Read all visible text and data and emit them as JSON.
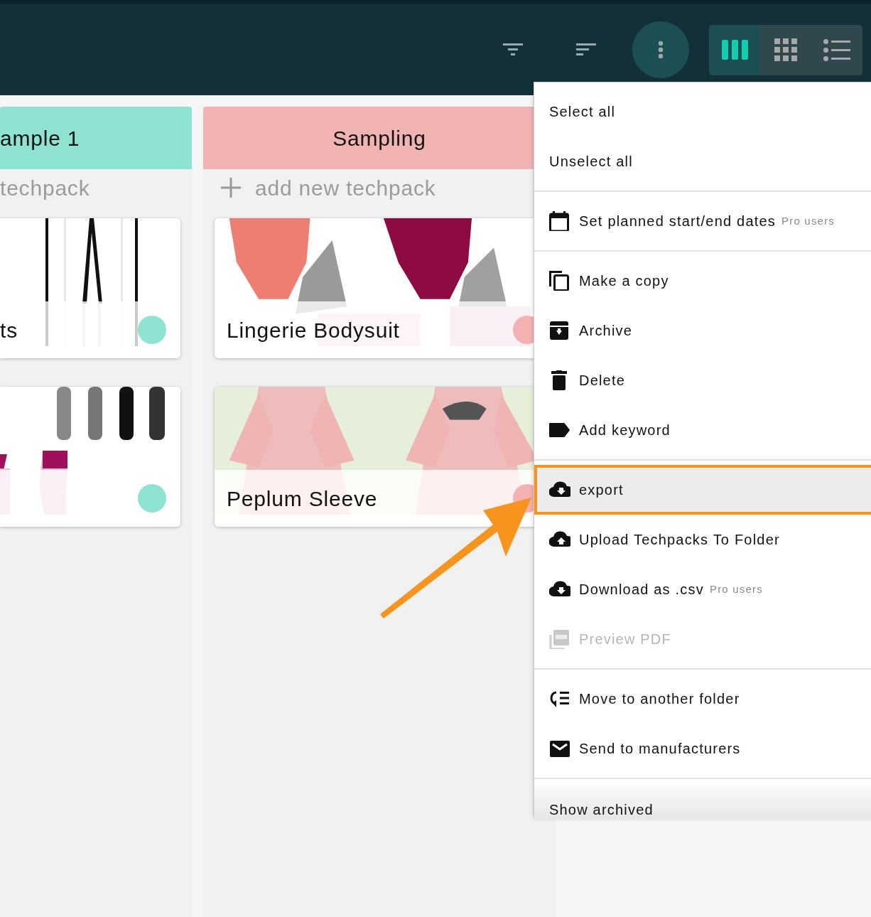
{
  "toolbar": {
    "view_modes": [
      {
        "kind": "columns",
        "selected": true
      },
      {
        "kind": "grid",
        "selected": false
      },
      {
        "kind": "list",
        "selected": false
      }
    ]
  },
  "columns": [
    {
      "title": "ample 1",
      "color": "#8fe3d2",
      "cut_off_left": true,
      "add_label": "techpack",
      "cards": [
        {
          "title": "ts",
          "color": "#8fe3d2",
          "kind": "picture"
        },
        {
          "color": "#8fe3d2",
          "kind": "picture"
        }
      ]
    },
    {
      "title": "Sampling",
      "color": "#f2b3b3",
      "cut_off_left": false,
      "add_label": "add new techpack",
      "cards": [
        {
          "title": "Lingerie Bodysuit",
          "color": "#f5b0b0",
          "kind": "picture"
        },
        {
          "title": "Peplum Sleeve",
          "color": "#f5b0b0",
          "kind": "picture"
        }
      ]
    }
  ],
  "menu": {
    "sections": [
      {
        "items": [
          {
            "kind": "plain",
            "label": "Select all",
            "disabled": false,
            "highlighted": false
          },
          {
            "kind": "plain",
            "label": "Unselect all",
            "disabled": false,
            "highlighted": false
          }
        ]
      },
      {
        "items": [
          {
            "kind": "dates",
            "label": "Set planned start/end dates",
            "note": "Pro users",
            "disabled": false,
            "highlighted": false
          }
        ]
      },
      {
        "items": [
          {
            "kind": "copy",
            "label": "Make a copy",
            "disabled": false,
            "highlighted": false
          },
          {
            "kind": "archive",
            "label": "Archive",
            "disabled": false,
            "highlighted": false
          },
          {
            "kind": "delete",
            "label": "Delete",
            "disabled": false,
            "highlighted": false
          },
          {
            "kind": "keyword",
            "label": "Add keyword",
            "disabled": false,
            "highlighted": false
          }
        ]
      },
      {
        "items": [
          {
            "kind": "export",
            "label": "export",
            "disabled": false,
            "highlighted": true
          },
          {
            "kind": "upload",
            "label": "Upload Techpacks To Folder",
            "disabled": false,
            "highlighted": false
          },
          {
            "kind": "download",
            "label": "Download as .csv",
            "note": "Pro users",
            "disabled": false,
            "highlighted": false
          },
          {
            "kind": "preview",
            "label": "Preview PDF",
            "disabled": true,
            "highlighted": false
          }
        ]
      },
      {
        "items": [
          {
            "kind": "move",
            "label": "Move to another folder",
            "disabled": false,
            "highlighted": false
          },
          {
            "kind": "send",
            "label": "Send to manufacturers",
            "disabled": false,
            "highlighted": false
          }
        ]
      }
    ],
    "footer": {
      "label": "Show archived"
    }
  }
}
